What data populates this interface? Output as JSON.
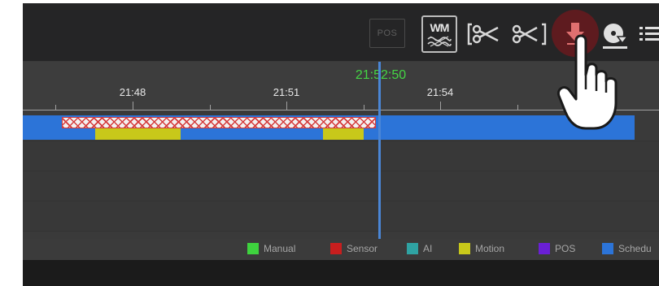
{
  "toolbar": {
    "pos_label": "POS",
    "wm_label": "WM",
    "icons": [
      "pos-icon",
      "watermark-icon",
      "clip-bracket-icon",
      "scissors-icon",
      "download-icon",
      "disk-backup-icon",
      "list-icon"
    ],
    "download_highlight_color": "#5e1b1f"
  },
  "timeline": {
    "cursor_time": "21:52:50",
    "ticks": [
      "21:48",
      "21:51",
      "21:54"
    ],
    "colors": {
      "schedule": "#2c74d8",
      "motion": "#c8c81a",
      "cursor": "#4a86d6",
      "cursor_label": "#44d544"
    }
  },
  "legend": {
    "items": [
      {
        "label": "Manual",
        "color": "#3ed23e"
      },
      {
        "label": "Sensor",
        "color": "#c81e1e"
      },
      {
        "label": "AI",
        "color": "#2fa3a3"
      },
      {
        "label": "Motion",
        "color": "#c8c81a"
      },
      {
        "label": "POS",
        "color": "#6a1fd6"
      },
      {
        "label": "Schedu",
        "color": "#2c74d8"
      }
    ]
  }
}
